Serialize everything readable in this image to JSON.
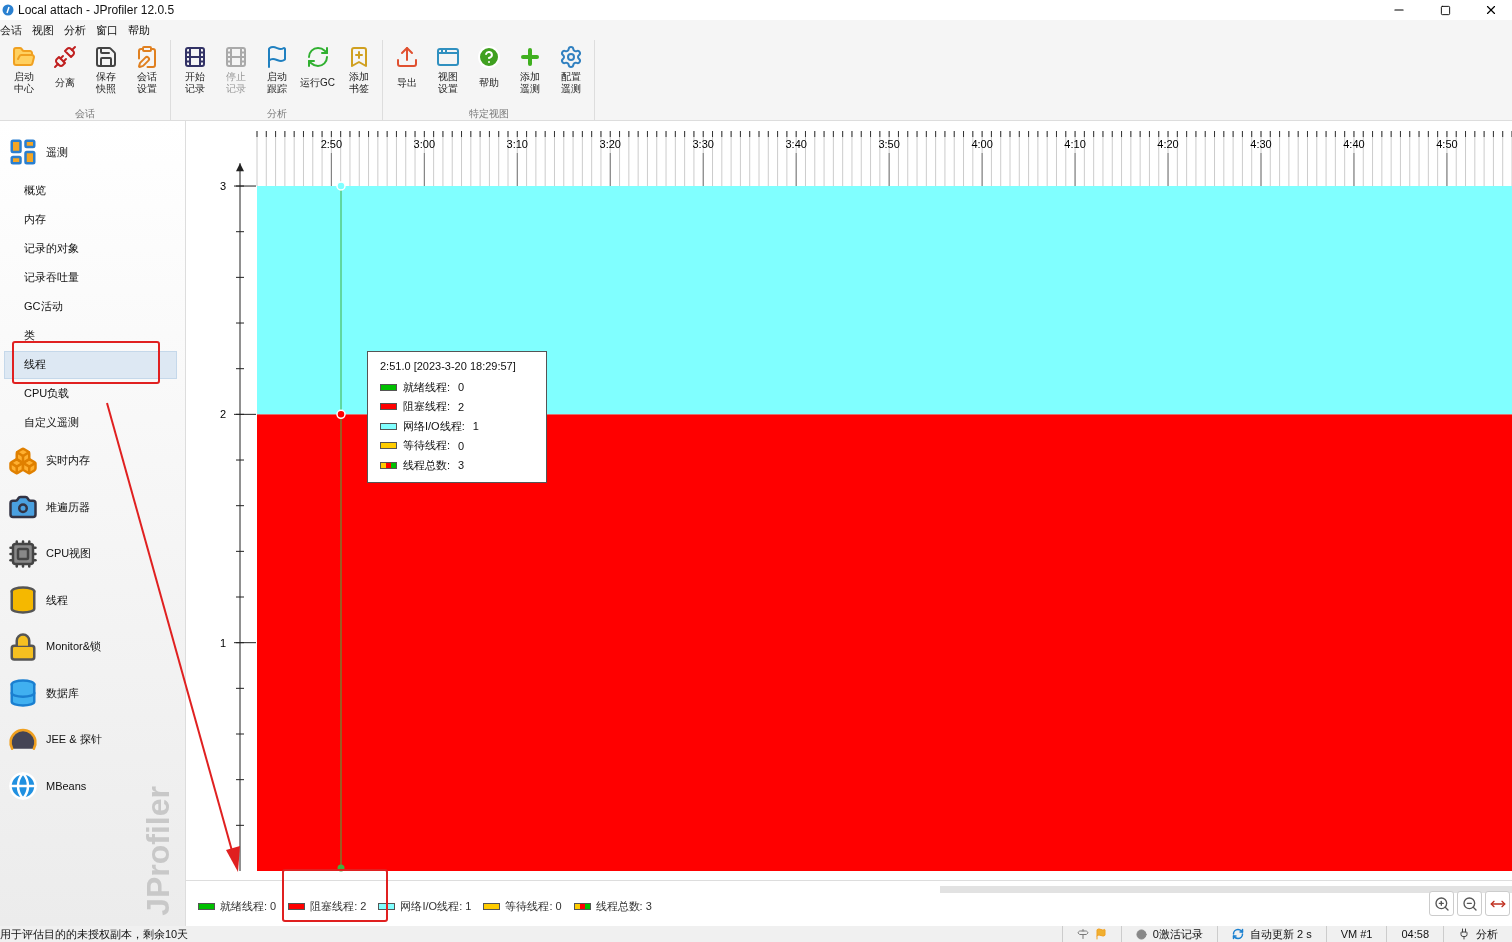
{
  "window": {
    "title": "Local attach - JProfiler 12.0.5"
  },
  "menu": [
    "会话",
    "视图",
    "分析",
    "窗口",
    "帮助"
  ],
  "toolbar": {
    "groups": [
      {
        "label": "会话",
        "buttons": [
          {
            "label": "启动中心",
            "disabled": false
          },
          {
            "label": "分离",
            "disabled": false
          },
          {
            "label": "保存快照",
            "disabled": false
          },
          {
            "label": "会话设置",
            "disabled": false
          }
        ]
      },
      {
        "label": "分析",
        "buttons": [
          {
            "label": "开始记录",
            "disabled": false
          },
          {
            "label": "停止记录",
            "disabled": true
          },
          {
            "label": "启动跟踪",
            "disabled": false
          },
          {
            "label": "运行GC",
            "disabled": false
          },
          {
            "label": "添加书签",
            "disabled": false
          }
        ]
      },
      {
        "label": "特定视图",
        "buttons": [
          {
            "label": "导出",
            "disabled": false
          },
          {
            "label": "视图设置",
            "disabled": false
          },
          {
            "label": "帮助",
            "disabled": false
          },
          {
            "label": "添加遥测",
            "disabled": false
          },
          {
            "label": "配置遥测",
            "disabled": false
          }
        ]
      }
    ]
  },
  "sidebar": {
    "brand": "JProfiler",
    "sections": [
      {
        "label": "遥测",
        "selected": false,
        "children": [
          {
            "label": "概览",
            "selected": false
          },
          {
            "label": "内存",
            "selected": false
          },
          {
            "label": "记录的对象",
            "selected": false
          },
          {
            "label": "记录吞吐量",
            "selected": false
          },
          {
            "label": "GC活动",
            "selected": false
          },
          {
            "label": "类",
            "selected": false
          },
          {
            "label": "线程",
            "selected": true
          },
          {
            "label": "CPU负载",
            "selected": false
          },
          {
            "label": "自定义遥测",
            "selected": false
          }
        ]
      },
      {
        "label": "实时内存",
        "selected": false
      },
      {
        "label": "堆遍历器",
        "selected": false
      },
      {
        "label": "CPU视图",
        "selected": false
      },
      {
        "label": "线程",
        "selected": false
      },
      {
        "label": "Monitor&锁",
        "selected": false
      },
      {
        "label": "数据库",
        "selected": false
      },
      {
        "label": "JEE & 探针",
        "selected": false
      },
      {
        "label": "MBeans",
        "selected": false
      }
    ]
  },
  "chart": {
    "chart_data": {
      "type": "area",
      "stacked": true,
      "x": [
        162,
        297
      ],
      "xlim": [
        162,
        297
      ],
      "ylim": [
        0,
        3.1
      ],
      "xticks": [
        {
          "value": 170,
          "label": "2:50"
        },
        {
          "value": 180,
          "label": "3:00"
        },
        {
          "value": 190,
          "label": "3:10"
        },
        {
          "value": 200,
          "label": "3:20"
        },
        {
          "value": 210,
          "label": "3:30"
        },
        {
          "value": 220,
          "label": "3:40"
        },
        {
          "value": 230,
          "label": "3:50"
        },
        {
          "value": 240,
          "label": "4:00"
        },
        {
          "value": 250,
          "label": "4:10"
        },
        {
          "value": 260,
          "label": "4:20"
        },
        {
          "value": 270,
          "label": "4:30"
        },
        {
          "value": 280,
          "label": "4:40"
        },
        {
          "value": 290,
          "label": "4:50"
        }
      ],
      "yticks": [
        1,
        2,
        3
      ],
      "series": [
        {
          "color": "#ff0000",
          "values": [
            2,
            2
          ]
        },
        {
          "color": "#80ffff",
          "values": [
            1,
            1
          ]
        }
      ]
    }
  },
  "tooltip": {
    "title": "2:51.0 [2023-3-20 18:29:57]",
    "entries": [
      {
        "kind": "swatch",
        "color": "#00c000",
        "label": "就绪线程:",
        "value": "0"
      },
      {
        "kind": "swatch",
        "color": "#ff0000",
        "label": "阻塞线程:",
        "value": "2"
      },
      {
        "kind": "swatch",
        "color": "#80ffff",
        "label": "网络I/O线程:",
        "value": "1"
      },
      {
        "kind": "swatch",
        "color": "#ffcc00",
        "label": "等待线程:",
        "value": "0"
      },
      {
        "kind": "total",
        "label": "线程总数:",
        "value": "3"
      }
    ]
  },
  "legend": [
    {
      "kind": "swatch",
      "color": "#00c000",
      "label": "就绪线程: 0"
    },
    {
      "kind": "swatch",
      "color": "#ff0000",
      "label": "阻塞线程: 2"
    },
    {
      "kind": "swatch",
      "color": "#80ffff",
      "label": "网络I/O线程: 1"
    },
    {
      "kind": "swatch",
      "color": "#ffcc00",
      "label": "等待线程: 0"
    },
    {
      "kind": "total",
      "label": "线程总数: 3"
    }
  ],
  "status_bar": {
    "message": "用于评估目的的未授权副本，剩余10天",
    "items": [
      {
        "kind": "flags"
      },
      {
        "kind": "record",
        "label": "0激活记录"
      },
      {
        "kind": "refresh",
        "label": "自动更新 2 s"
      },
      {
        "kind": "plain",
        "label": "VM #1"
      },
      {
        "kind": "plain",
        "label": "04:58"
      },
      {
        "kind": "plug",
        "label": "分析"
      }
    ]
  }
}
